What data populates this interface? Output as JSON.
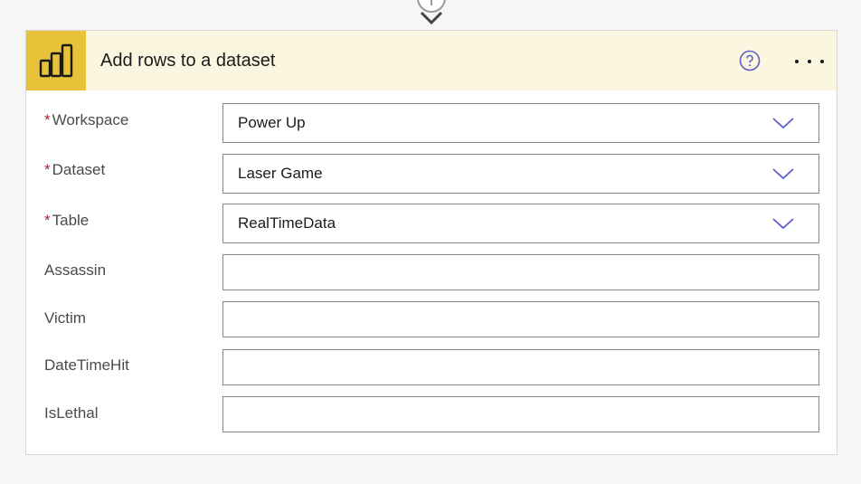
{
  "action": {
    "title": "Add rows to a dataset",
    "icon": "power-bi-icon",
    "help_icon": "question-circle-icon",
    "more_icon": "ellipsis-icon",
    "accent_color": "#e8c33a",
    "header_bg": "#fbf6df"
  },
  "connector": {
    "icon": "plus-circle-icon",
    "arrow_icon": "arrow-down-icon"
  },
  "required_marker": "*",
  "fields": {
    "workspace": {
      "label": "Workspace",
      "value": "Power Up",
      "required": true
    },
    "dataset": {
      "label": "Dataset",
      "value": "Laser Game",
      "required": true
    },
    "table": {
      "label": "Table",
      "value": "RealTimeData",
      "required": true
    },
    "assassin": {
      "label": "Assassin",
      "value": "",
      "required": false
    },
    "victim": {
      "label": "Victim",
      "value": "",
      "required": false
    },
    "datetimehit": {
      "label": "DateTimeHit",
      "value": "",
      "required": false
    },
    "islethal": {
      "label": "IsLethal",
      "value": "",
      "required": false
    }
  }
}
